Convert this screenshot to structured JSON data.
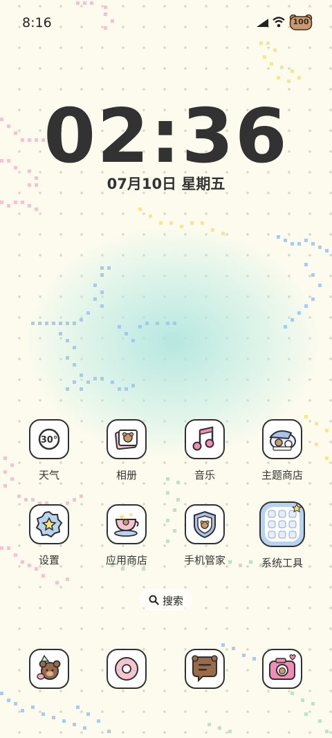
{
  "status_bar": {
    "time": "8:16",
    "battery": "100"
  },
  "lockscreen": {
    "clock": "02:36",
    "date": "07月10日 星期五"
  },
  "apps_row1": [
    {
      "label": "天气",
      "icon": "weather-icon",
      "badge": "30°"
    },
    {
      "label": "相册",
      "icon": "gallery-icon"
    },
    {
      "label": "音乐",
      "icon": "music-icon"
    },
    {
      "label": "主题商店",
      "icon": "theme-store-icon"
    }
  ],
  "apps_row2": [
    {
      "label": "设置",
      "icon": "settings-icon"
    },
    {
      "label": "应用商店",
      "icon": "app-store-icon"
    },
    {
      "label": "手机管家",
      "icon": "phone-manager-icon"
    },
    {
      "label": "系统工具",
      "icon": "system-tools-folder-icon"
    }
  ],
  "search": {
    "label": "搜索"
  },
  "dock": [
    {
      "icon": "phone-icon"
    },
    {
      "icon": "messages-icon"
    },
    {
      "icon": "chat-icon"
    },
    {
      "icon": "camera-icon"
    }
  ],
  "colors": {
    "background": "#fcfbee",
    "text": "#323232",
    "glow": "#aae4de",
    "pink": "#f2a7c3",
    "blue": "#9cc4ec",
    "yellow": "#f0e58c",
    "green": "#b7e0c4"
  }
}
